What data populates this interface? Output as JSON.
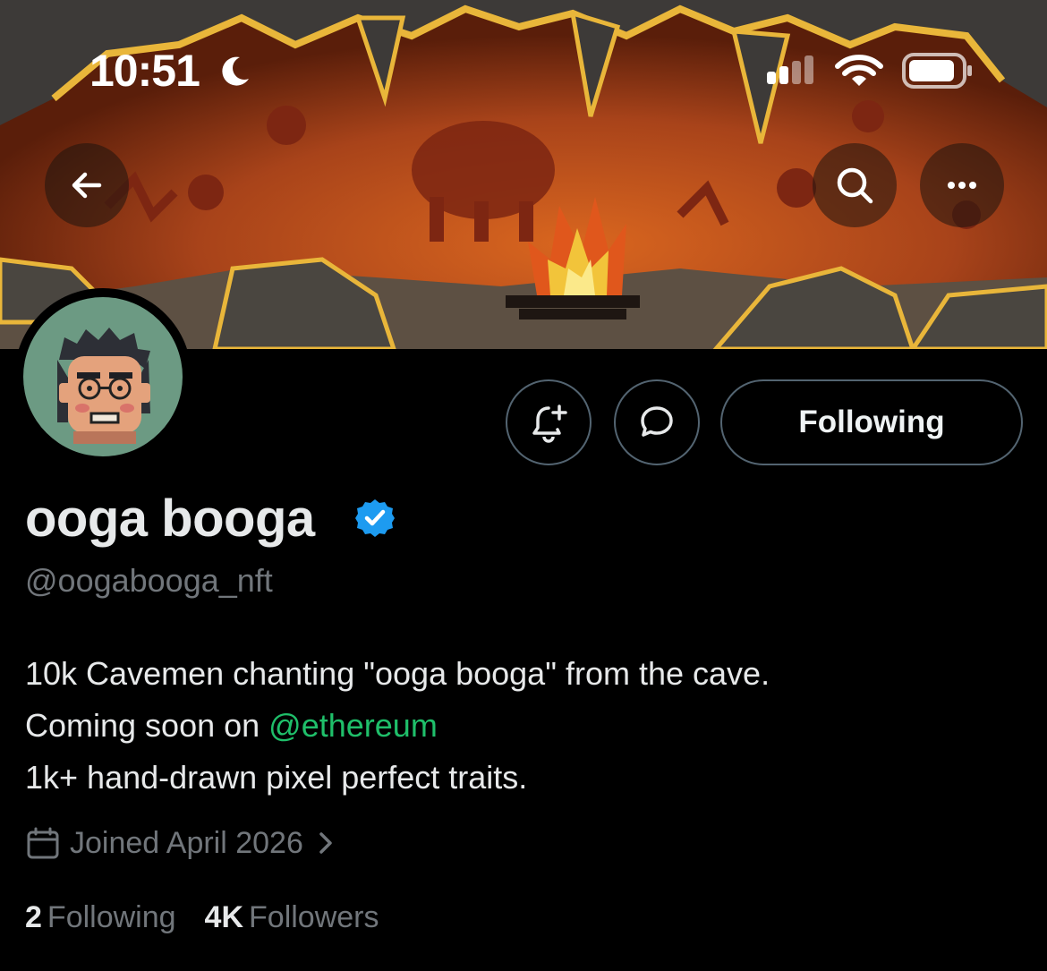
{
  "status_bar": {
    "time": "10:51"
  },
  "profile": {
    "display_name": "ooga booga",
    "handle": "@oogabooga_nft",
    "verified": true,
    "bio_line1": "10k Cavemen chanting \"ooga booga\" from the cave.",
    "bio_line2_prefix": "Coming soon on ",
    "bio_line2_mention": "@ethereum",
    "bio_line3": "1k+ hand-drawn pixel perfect traits.",
    "joined": "Joined April 2026"
  },
  "actions": {
    "following_label": "Following"
  },
  "stats": {
    "following_count": "2",
    "following_label": "Following",
    "followers_count": "4K",
    "followers_label": "Followers"
  },
  "colors": {
    "background": "#000000",
    "verified_blue": "#1d9bf0",
    "mention_green": "#1fbf6a",
    "muted_text": "#71767b",
    "avatar_bg": "#6c9a83"
  },
  "icons": [
    "moon-icon",
    "signal-icon",
    "wifi-icon",
    "battery-icon",
    "back-arrow-icon",
    "search-icon",
    "more-icon",
    "bell-plus-icon",
    "message-icon",
    "verified-icon",
    "calendar-icon",
    "chevron-right-icon"
  ]
}
